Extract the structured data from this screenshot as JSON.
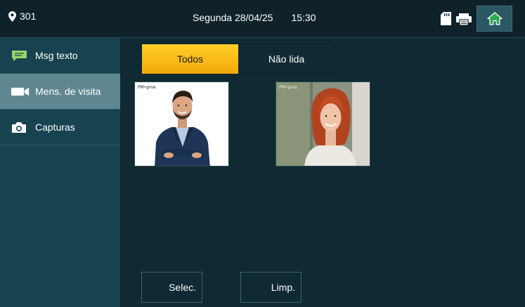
{
  "header": {
    "room": "301",
    "day_date": "Segunda 28/04/25",
    "time": "15:30"
  },
  "sidebar": {
    "items": [
      {
        "label": "Msg texto",
        "icon": "message-icon"
      },
      {
        "label": "Mens. de visita",
        "icon": "video-camera-icon",
        "active": true
      },
      {
        "label": "Capturas",
        "icon": "camera-icon"
      }
    ]
  },
  "tabs": [
    {
      "label": "Todos",
      "active": true
    },
    {
      "label": "Não lida",
      "active": false
    }
  ],
  "thumbnails": [
    {
      "label": "PM•pme"
    },
    {
      "label": "PM•pme"
    }
  ],
  "actions": {
    "select_label": "Selec.",
    "clear_label": "Limp."
  },
  "colors": {
    "accent": "#f4a70a",
    "sidebar": "#17424f",
    "active_item": "#5e8791",
    "home_icon": "#2fa84f"
  }
}
